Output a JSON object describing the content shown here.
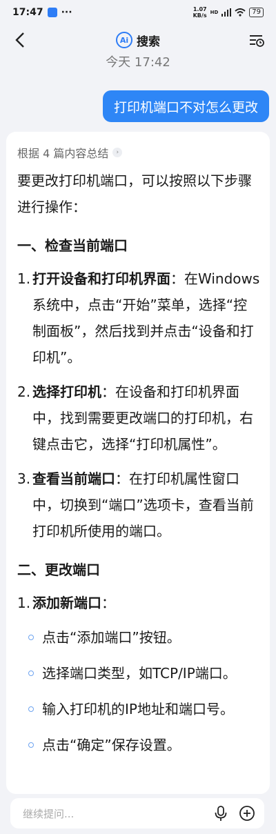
{
  "status": {
    "time": "17:47",
    "app_icon": "alipay-badge-icon",
    "dots": "···",
    "speed_value": "1.07",
    "speed_unit": "KB/s",
    "network": "HD",
    "battery": "79"
  },
  "nav": {
    "title": "搜索",
    "logo_text": "Ai"
  },
  "chat": {
    "timestamp": "今天 17:42",
    "user_question": "打印机端口不对怎么更改",
    "source_label": "根据 4 篇内容总结",
    "intro": "要更改打印机端口，可以按照以下步骤进行操作：",
    "section1": "一、检查当前端口",
    "s1_items": [
      {
        "num": "1.",
        "bold": "打开设备和打印机界面",
        "text": "：在Windows系统中，点击“开始”菜单，选择“控制面板”，然后找到并点击“设备和打印机”。"
      },
      {
        "num": "2.",
        "bold": "选择打印机",
        "text": "：在设备和打印机界面中，找到需要更改端口的打印机，右键点击它，选择“打印机属性”。"
      },
      {
        "num": "3.",
        "bold": "查看当前端口",
        "text": "：在打印机属性窗口中，切换到“端口”选项卡，查看当前打印机所使用的端口。"
      }
    ],
    "section2": "二、更改端口",
    "s2_item": {
      "num": "1.",
      "bold": "添加新端口",
      "text": "："
    },
    "bullets": [
      "点击“添加端口”按钮。",
      "选择端口类型，如TCP/IP端口。",
      "输入打印机的IP地址和端口号。",
      "点击“确定”保存设置。"
    ]
  },
  "input": {
    "placeholder": "继续提问..."
  },
  "colors": {
    "accent": "#2e86f6",
    "background": "#f2f3f7"
  }
}
